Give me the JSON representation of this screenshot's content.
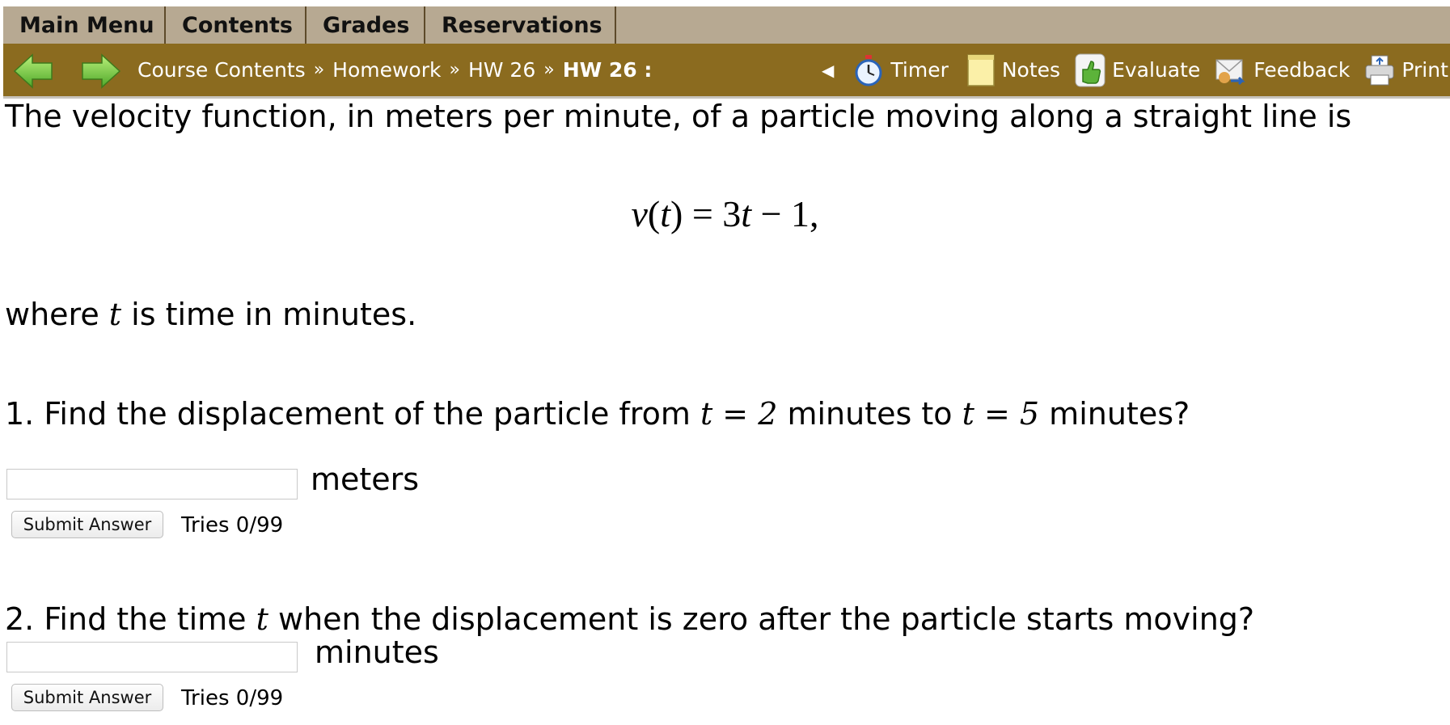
{
  "topnav": {
    "tabs": [
      {
        "label": "Main Menu"
      },
      {
        "label": "Contents"
      },
      {
        "label": "Grades"
      },
      {
        "label": "Reservations"
      }
    ]
  },
  "toolbar": {
    "breadcrumb": [
      "Course Contents",
      "Homework",
      "HW 26",
      "HW 26 :"
    ],
    "separator": "»",
    "collapse_glyph": "◀",
    "tools": [
      {
        "label": "Timer",
        "icon": "stopwatch-icon"
      },
      {
        "label": "Notes",
        "icon": "notepad-icon"
      },
      {
        "label": "Evaluate",
        "icon": "thumbs-up-icon"
      },
      {
        "label": "Feedback",
        "icon": "feedback-icon"
      },
      {
        "label": "Print",
        "icon": "printer-icon"
      }
    ],
    "colors": {
      "toolbar_bg": "#8b6b1f",
      "tabs_bg": "#b7a992"
    }
  },
  "problem": {
    "intro": "The velocity function, in meters per minute, of a particle moving along a straight line is",
    "formula": {
      "lhs_fn": "v",
      "var": "t",
      "rhs_coef": "3",
      "rhs_const": "1"
    },
    "where_pre": "where ",
    "where_var": "t",
    "where_post": " is time in minutes.",
    "q1": {
      "text_a": "1. Find the displacement of the particle from ",
      "var1": "t",
      "eq1": " = 2",
      "text_b": " minutes to ",
      "var2": "t",
      "eq2": " = 5",
      "text_c": " minutes?",
      "unit": "meters",
      "input_value": "",
      "submit_label": "Submit Answer",
      "tries": "Tries 0/99"
    },
    "q2": {
      "text_a": "2. Find the time ",
      "var1": "t",
      "text_b": " when the displacement is zero after the particle starts moving?",
      "unit": "minutes",
      "input_value": "",
      "submit_label": "Submit Answer",
      "tries": "Tries 0/99"
    }
  }
}
